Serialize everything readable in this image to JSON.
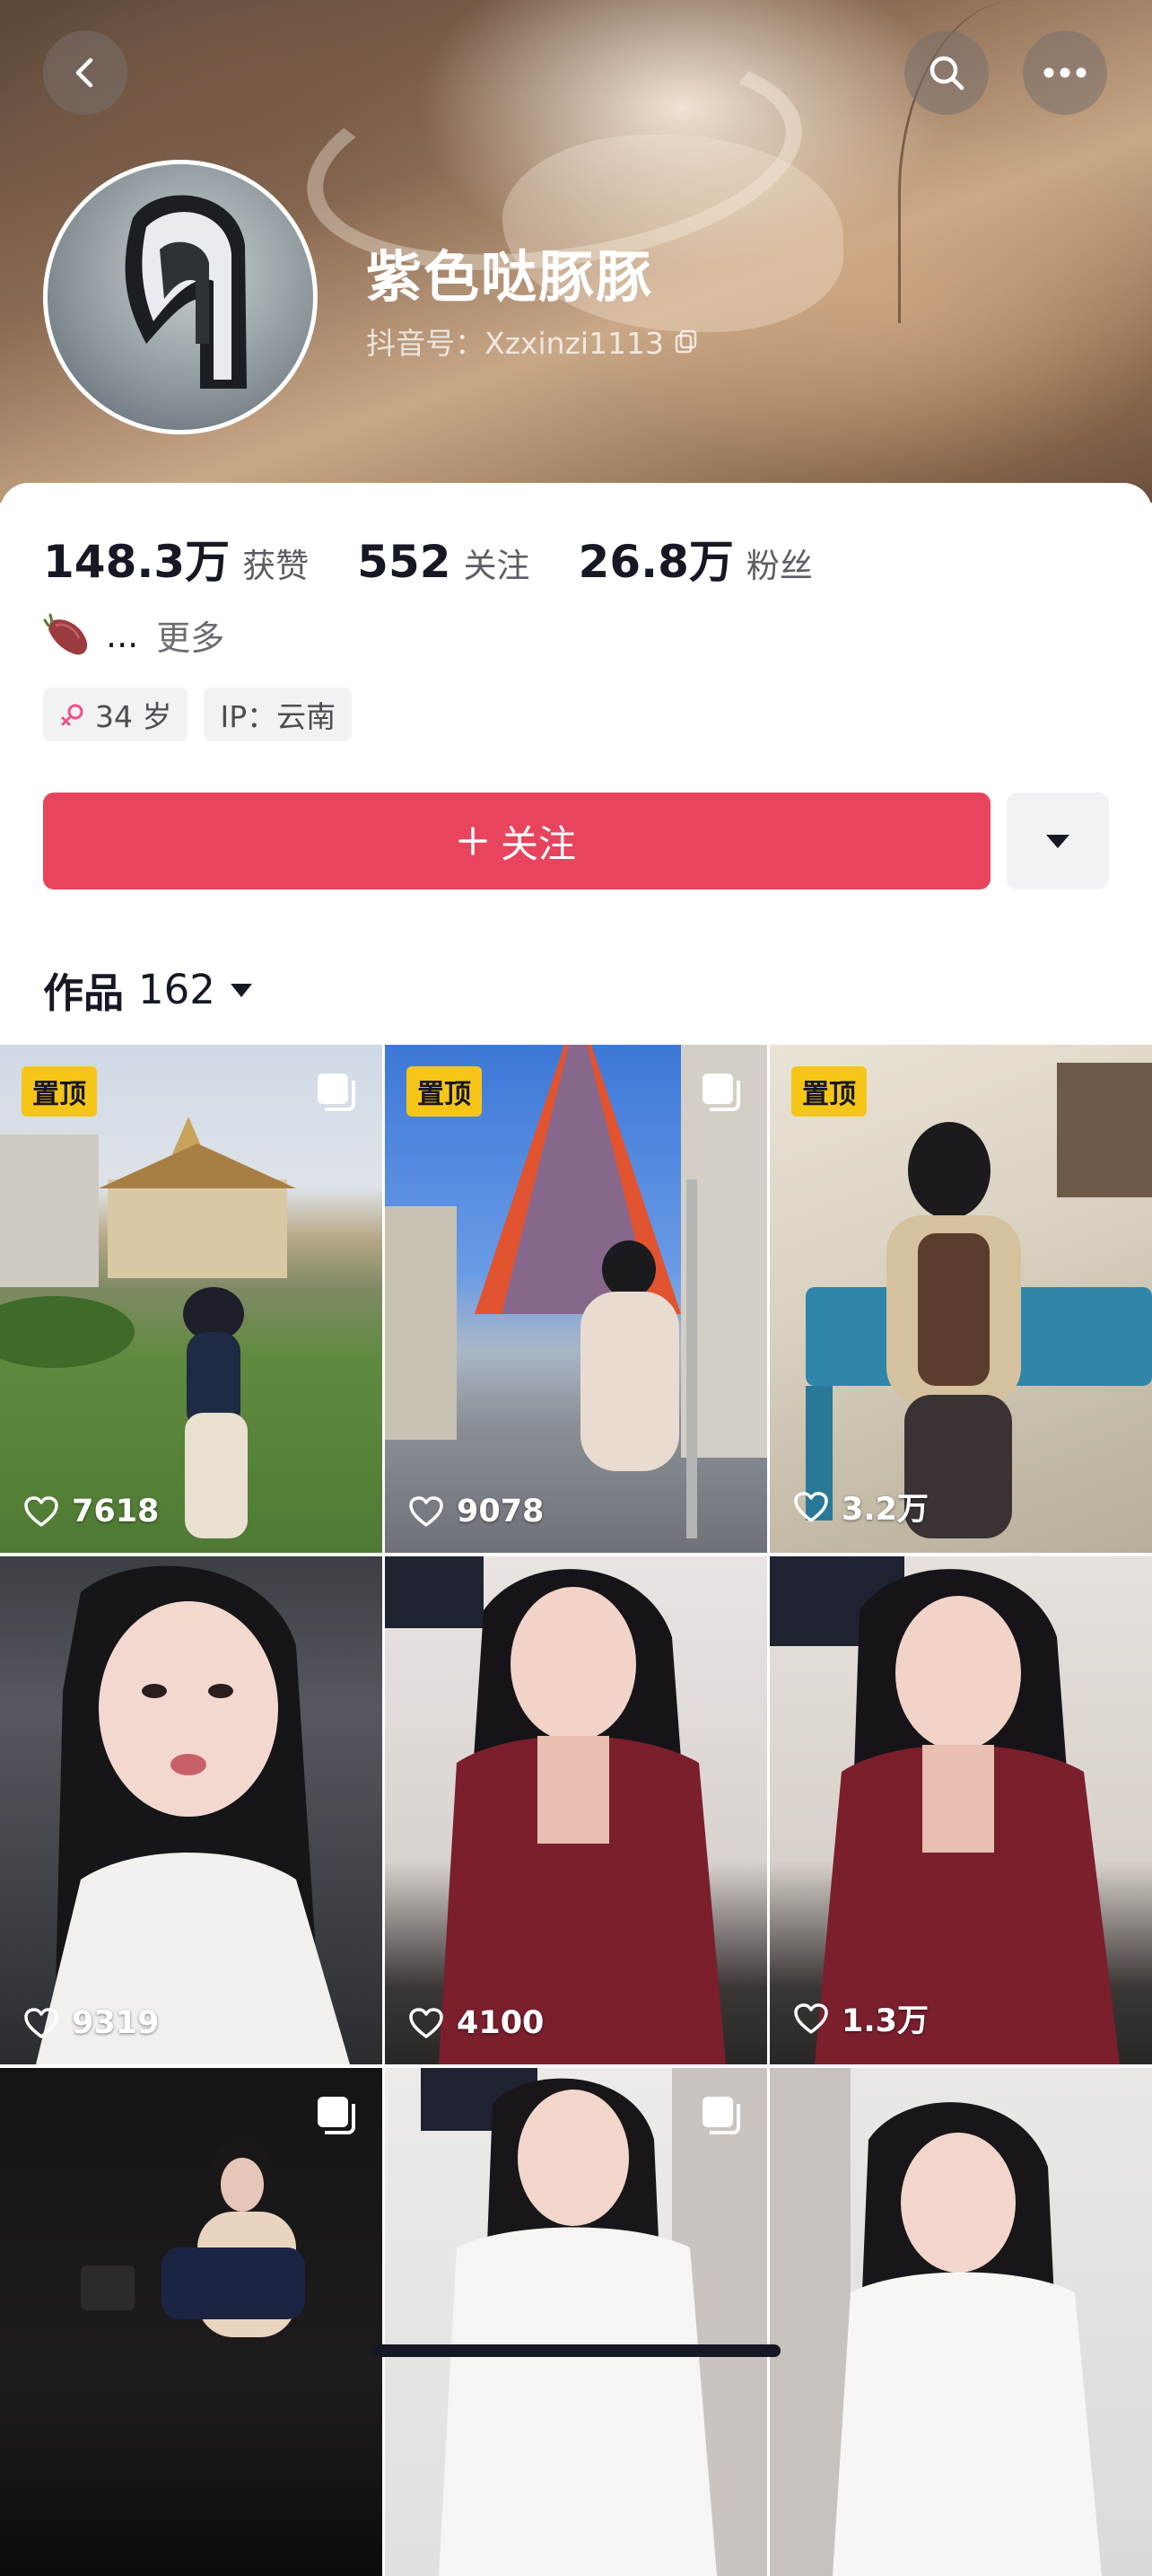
{
  "profile": {
    "nickname": "紫色哒豚豚",
    "douyin_id": "抖音号：Xzxinzi1113"
  },
  "stats": [
    {
      "value": "148.3万",
      "label": "获赞"
    },
    {
      "value": "552",
      "label": "关注"
    },
    {
      "value": "26.8万",
      "label": "粉丝"
    }
  ],
  "bio": {
    "text": "...",
    "more": "更多",
    "emoji": "sweet-potato"
  },
  "tags": {
    "age": "34 岁",
    "ip": "IP：云南"
  },
  "actions": {
    "follow_label": "关注",
    "follow_color": "#e8445d"
  },
  "works": {
    "title": "作品",
    "count": "162"
  },
  "videos": [
    {
      "pinned": "置顶",
      "likes": "7618",
      "multi": true
    },
    {
      "pinned": "置顶",
      "likes": "9078",
      "multi": true
    },
    {
      "pinned": "置顶",
      "likes": "3.2万",
      "multi": false
    },
    {
      "pinned": "",
      "likes": "9319",
      "multi": false
    },
    {
      "pinned": "",
      "likes": "4100",
      "multi": false
    },
    {
      "pinned": "",
      "likes": "1.3万",
      "multi": false
    },
    {
      "pinned": "",
      "likes": "",
      "multi": true
    },
    {
      "pinned": "",
      "likes": "",
      "multi": true
    },
    {
      "pinned": "",
      "likes": "",
      "multi": false
    }
  ],
  "icons": {
    "back": "back-arrow-icon",
    "search": "search-icon",
    "more": "more-dots-icon",
    "copy": "copy-icon",
    "female": "female-icon",
    "dropdown": "triangle-down-icon",
    "heart": "heart-icon",
    "multi": "multi-image-icon"
  },
  "colors": {
    "pin_badge": "#f5c518",
    "accent": "#e8445d"
  }
}
